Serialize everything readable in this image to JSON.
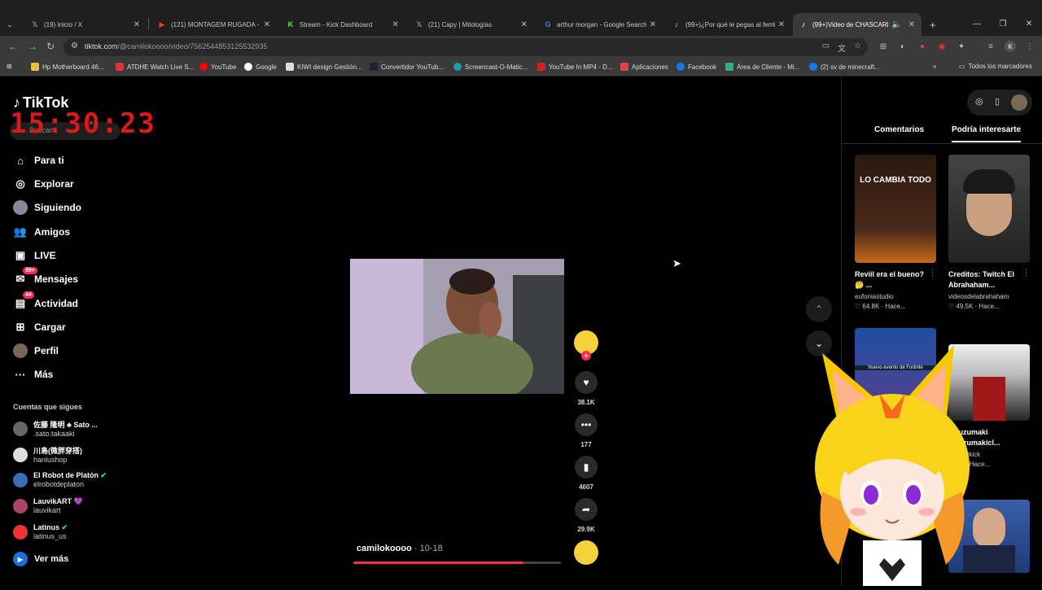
{
  "browser": {
    "tabs": [
      {
        "title": "(19) Inicio / X",
        "favicon": "x-icon",
        "active": false
      },
      {
        "title": "(121) MONTAGEM RUGADA - Y",
        "favicon": "youtube-icon",
        "active": false
      },
      {
        "title": "Stream - Kick Dashboard",
        "favicon": "kick-icon",
        "active": false
      },
      {
        "title": "(21) Capy | Mitologías",
        "favicon": "x-icon",
        "active": false
      },
      {
        "title": "arthur morgan - Google Search",
        "favicon": "google-icon",
        "active": false
      },
      {
        "title": "(99+)¿Por qué le pegas al femb",
        "favicon": "tiktok-icon",
        "active": false
      },
      {
        "title": "(99+)Video de CHASCARR",
        "favicon": "tiktok-icon",
        "active": true
      }
    ],
    "url_host": "tiktok.com",
    "url_path": "/@camilokoooo/video/7562544853125532935",
    "bookmarks": [
      {
        "label": "Hp Motherboard 46...",
        "color": "#e8c04a"
      },
      {
        "label": "ATDHE Watch Live S...",
        "color": "#d33"
      },
      {
        "label": "YouTube",
        "color": "#f00"
      },
      {
        "label": "Google",
        "color": "#fff"
      },
      {
        "label": "KIWI design Gestión...",
        "color": "#fff"
      },
      {
        "label": "Convertidor YouTub...",
        "color": "#223"
      },
      {
        "label": "Screencast-O-Matic...",
        "color": "#29a"
      },
      {
        "label": "YouTube In MP4 - D...",
        "color": "#c22"
      },
      {
        "label": "Aplicaciones",
        "color": "#d44"
      },
      {
        "label": "Facebook",
        "color": "#1877f2"
      },
      {
        "label": "Área de Cliente - Mi...",
        "color": "#3a8"
      },
      {
        "label": "(2) sv de minecraft...",
        "color": "#1877f2"
      }
    ],
    "all_bookmarks": "Todos los marcadores"
  },
  "tiktok": {
    "logo": "TikTok",
    "clock": "15:30:23",
    "search_placeholder": "Buscar",
    "nav": [
      {
        "label": "Para ti",
        "icon": "home-icon"
      },
      {
        "label": "Explorar",
        "icon": "compass-icon"
      },
      {
        "label": "Siguiendo",
        "icon": "following-icon"
      },
      {
        "label": "Amigos",
        "icon": "friends-icon"
      },
      {
        "label": "LIVE",
        "icon": "live-icon"
      },
      {
        "label": "Mensajes",
        "icon": "messages-icon",
        "badge": "99+"
      },
      {
        "label": "Actividad",
        "icon": "activity-icon",
        "badge": "44"
      },
      {
        "label": "Cargar",
        "icon": "upload-icon"
      },
      {
        "label": "Perfil",
        "icon": "profile-icon"
      },
      {
        "label": "Más",
        "icon": "more-icon"
      }
    ],
    "following_header": "Cuentas que sigues",
    "following": [
      {
        "name": "佐藤 隆明 ♣ Sato ...",
        "handle": ".sato.takaaki",
        "color": "#666"
      },
      {
        "name": "川島(微胖穿搭)",
        "handle": "hanlushop",
        "color": "#ddd"
      },
      {
        "name": "El Robot de Platón",
        "handle": "elrobotdeplaton",
        "color": "#3b6fb5",
        "verified": true
      },
      {
        "name": "LauvikART 💜",
        "handle": "lauvikart",
        "color": "#a46"
      },
      {
        "name": "Latinus",
        "handle": "latinus_us",
        "color": "#e33",
        "verified": true
      }
    ],
    "see_more": "Ver más",
    "video": {
      "author": "camilokoooo",
      "date": "10-18",
      "progress": 0.82
    },
    "actions": {
      "likes": "38.1K",
      "comments": "177",
      "saves": "4607",
      "shares": "29.9K"
    },
    "right_tabs": [
      "Comentarios",
      "Podría interesarte"
    ],
    "cards": [
      {
        "title": "Reviil era el bueno? 🤔 ...",
        "author": "eufoniastudio",
        "stats": "♡ 64.8K · Hace...",
        "thumb_text": "LO CAMBIA TODO"
      },
      {
        "title": "Creditos: Twitch El Abrahaham...",
        "author": "videosdelabrahaham",
        "stats": "♡ 49.5K · Hace...",
        "thumb_text": ""
      },
      {
        "title": "",
        "author": "",
        "stats": "",
        "thumb_text": "Nuevo evento de Fortnite"
      },
      {
        "title": "...auzumaki ...auzumakicl...",
        "author": "...chowkick",
        "stats": "... 5K · Hace...",
        "thumb_text": ""
      }
    ]
  }
}
